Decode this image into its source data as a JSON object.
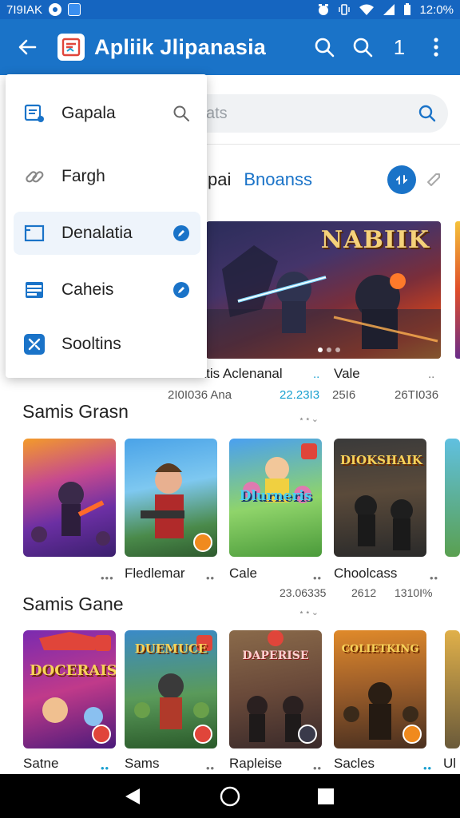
{
  "status_bar": {
    "left_text": "7I9IAK",
    "time": "12:0%"
  },
  "app_bar": {
    "title": "Apliik Jlipanasia",
    "count": "1"
  },
  "search": {
    "placeholder": "ats"
  },
  "menu": {
    "items": [
      {
        "label": "Gapala",
        "icon": "document-icon"
      },
      {
        "label": "Fargh",
        "icon": "link-icon"
      },
      {
        "label": "Denalatia",
        "icon": "window-icon"
      },
      {
        "label": "Caheis",
        "icon": "list-icon"
      },
      {
        "label": "Sooltins",
        "icon": "tools-icon"
      }
    ]
  },
  "featured": {
    "title": "pai",
    "accent": "Bnoanss",
    "banner_title": "NABIIK",
    "item_a": {
      "name": "tatis Aclenanal",
      "meta": "2I0I036 Ana",
      "rating": "22.23I3"
    },
    "item_b": {
      "name": "Vale",
      "meta": "25I6",
      "rating": "26TI036"
    }
  },
  "sections": [
    {
      "title": "Samis Grasn",
      "cards": [
        {
          "name": "",
          "meta": "",
          "logo": ""
        },
        {
          "name": "Fledlemar",
          "meta": "",
          "logo": ""
        },
        {
          "name": "Cale",
          "meta": "23.06335",
          "logo": "Dlurneris"
        },
        {
          "name": "Choolcass",
          "meta": "2612",
          "logo": "DIOKSHAIK"
        }
      ],
      "extra_meta": "1310I%"
    },
    {
      "title": "Samis Gane",
      "cards": [
        {
          "name": "Satne",
          "meta": "",
          "logo": "DOCERAIS"
        },
        {
          "name": "Sams",
          "meta": "",
          "logo": "DUEMUCE"
        },
        {
          "name": "Rapleise",
          "meta": "",
          "logo": "DAPERISE"
        },
        {
          "name": "Sacles",
          "meta": "",
          "logo": "COLIETKING"
        },
        {
          "name": "Ul",
          "meta": "",
          "logo": ""
        }
      ]
    }
  ],
  "colors": {
    "primary": "#1a73c8",
    "status_bar": "#1565c0",
    "accent_cyan": "#1aa0d0"
  }
}
